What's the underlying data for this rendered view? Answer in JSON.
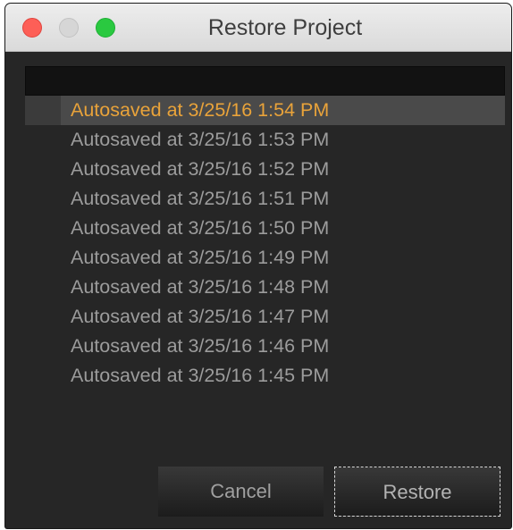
{
  "window": {
    "title": "Restore Project"
  },
  "search": {
    "value": ""
  },
  "autosaves": [
    {
      "label": "Autosaved at 3/25/16 1:54 PM",
      "selected": true
    },
    {
      "label": "Autosaved at 3/25/16 1:53 PM",
      "selected": false
    },
    {
      "label": "Autosaved at 3/25/16 1:52 PM",
      "selected": false
    },
    {
      "label": "Autosaved at 3/25/16 1:51 PM",
      "selected": false
    },
    {
      "label": "Autosaved at 3/25/16 1:50 PM",
      "selected": false
    },
    {
      "label": "Autosaved at 3/25/16 1:49 PM",
      "selected": false
    },
    {
      "label": "Autosaved at 3/25/16 1:48 PM",
      "selected": false
    },
    {
      "label": "Autosaved at 3/25/16 1:47 PM",
      "selected": false
    },
    {
      "label": "Autosaved at 3/25/16 1:46 PM",
      "selected": false
    },
    {
      "label": "Autosaved at 3/25/16 1:45 PM",
      "selected": false
    }
  ],
  "buttons": {
    "cancel": "Cancel",
    "restore": "Restore"
  },
  "colors": {
    "selected_text": "#e9a33a",
    "window_background": "#262626",
    "close": "#fd5f57",
    "minimize": "#d6d6d6",
    "zoom": "#2ac940"
  },
  "icons": {
    "close": "close-button",
    "minimize": "minimize-button",
    "zoom": "zoom-button"
  }
}
